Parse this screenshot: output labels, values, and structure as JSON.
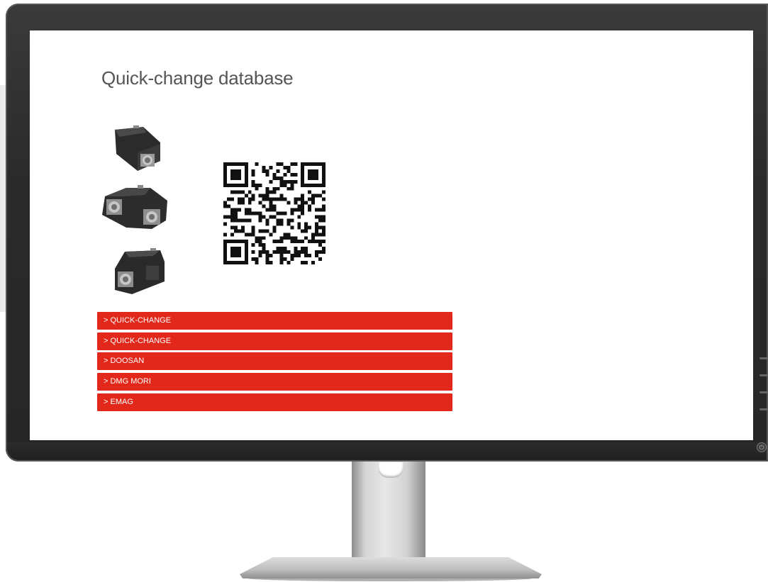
{
  "page": {
    "title": "Quick-change database"
  },
  "menu": {
    "items": [
      {
        "label": "> QUICK-CHANGE"
      },
      {
        "label": "> QUICK-CHANGE"
      },
      {
        "label": "> DOOSAN"
      },
      {
        "label": "> DMG MORI"
      },
      {
        "label": "> EMAG"
      }
    ]
  },
  "colors": {
    "accent": "#e2281b",
    "bezel": "#2a2a2a",
    "title_text": "#555555"
  },
  "icons": {
    "qr": "qr-code-icon",
    "power": "power-icon"
  }
}
